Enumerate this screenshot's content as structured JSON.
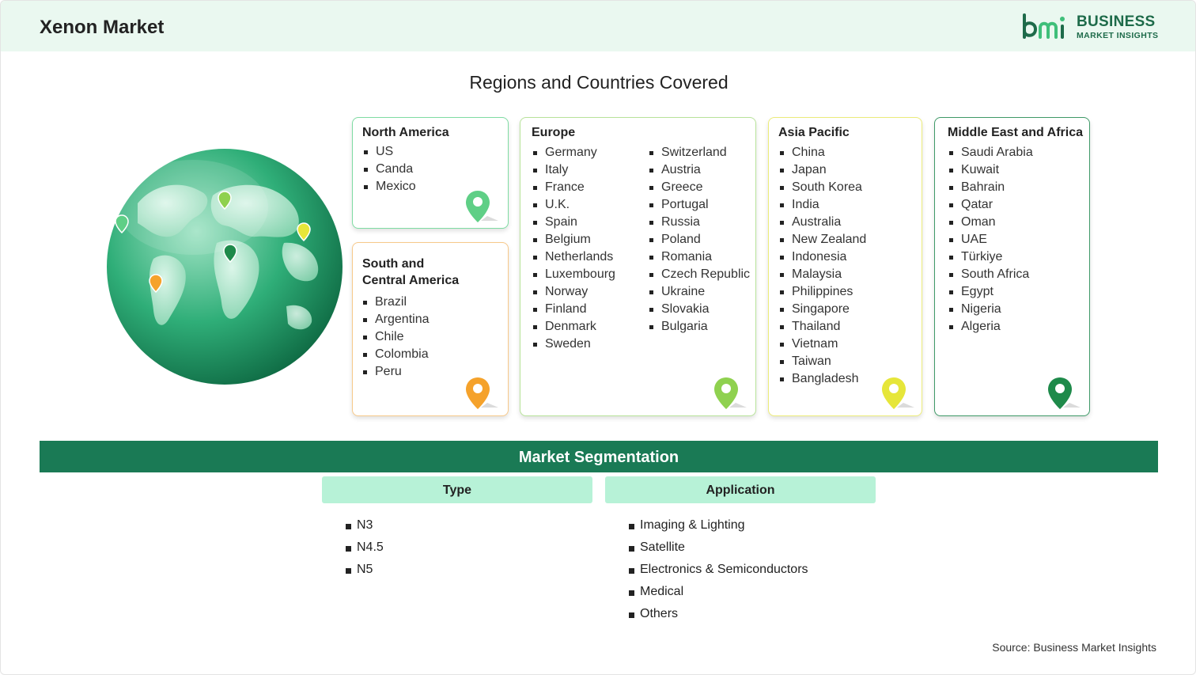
{
  "header": {
    "title": "Xenon Market"
  },
  "logo": {
    "line1": "BUSINESS",
    "line2": "MARKET INSIGHTS"
  },
  "section_title": "Regions and Countries Covered",
  "regions": {
    "north_america": {
      "title": "North America",
      "countries": [
        "US",
        "Canda",
        "Mexico"
      ],
      "color": "#5fcf86"
    },
    "south_central_america": {
      "title_line1": "South and",
      "title_line2": "Central America",
      "countries": [
        "Brazil",
        "Argentina",
        "Chile",
        "Colombia",
        "Peru"
      ],
      "color": "#f5a22b"
    },
    "europe": {
      "title": "Europe",
      "countries_col1": [
        "Germany",
        "Italy",
        "France",
        "U.K.",
        "Spain",
        "Belgium",
        "Netherlands",
        "Luxembourg",
        "Norway",
        "Finland",
        "Denmark",
        "Sweden"
      ],
      "countries_col2": [
        "Switzerland",
        "Austria",
        "Greece",
        "Portugal",
        "Russia",
        "Poland",
        "Romania",
        "Czech Republic",
        "Ukraine",
        "Slovakia",
        "Bulgaria"
      ],
      "color": "#8fd14f"
    },
    "asia_pacific": {
      "title": "Asia Pacific",
      "countries": [
        "China",
        "Japan",
        "South Korea",
        "India",
        "Australia",
        "New Zealand",
        "Indonesia",
        "Malaysia",
        "Philippines",
        "Singapore",
        "Thailand",
        "Vietnam",
        "Taiwan",
        "Bangladesh"
      ],
      "color": "#e6e63a"
    },
    "middle_east_africa": {
      "title": "Middle East and Africa",
      "countries": [
        "Saudi Arabia",
        "Kuwait",
        "Bahrain",
        "Qatar",
        "Oman",
        "UAE",
        "Türkiye",
        "South Africa",
        "Egypt",
        "Nigeria",
        "Algeria"
      ],
      "color": "#1e8a4a"
    }
  },
  "segmentation": {
    "title": "Market Segmentation",
    "type": {
      "header": "Type",
      "items": [
        "N3",
        "N4.5",
        "N5"
      ]
    },
    "application": {
      "header": "Application",
      "items": [
        "Imaging & Lighting",
        "Satellite",
        "Electronics & Semiconductors",
        "Medical",
        "Others"
      ]
    }
  },
  "source": "Source: Business Market Insights",
  "colors": {
    "brand_green": "#1a7a55",
    "header_bg": "#eaf8f0",
    "seg_header_bg": "#b7f2d7"
  }
}
